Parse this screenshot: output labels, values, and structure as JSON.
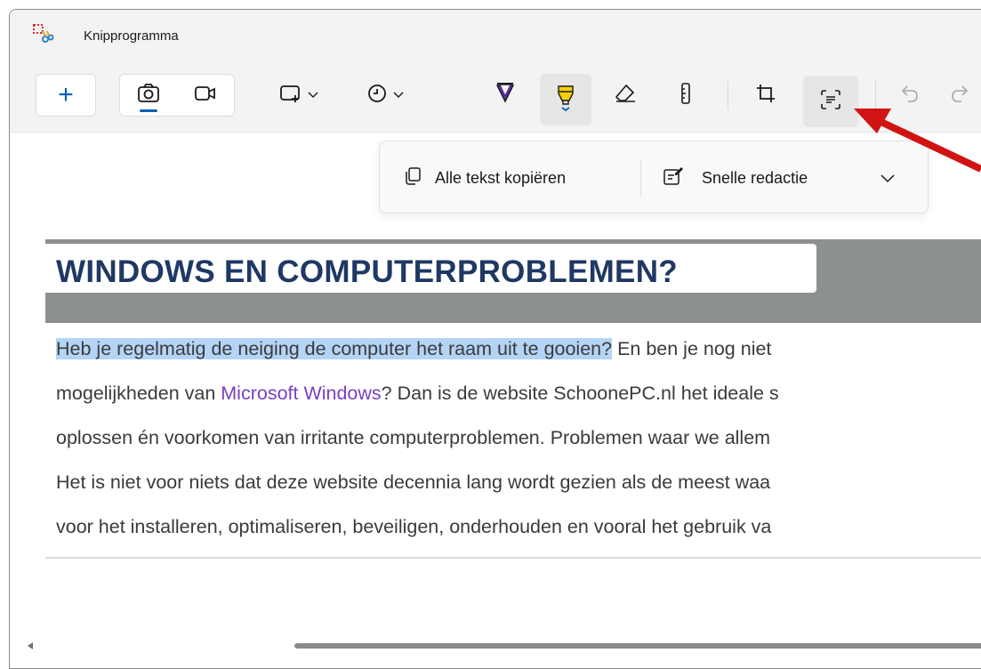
{
  "window": {
    "title": "Knipprogramma"
  },
  "toolbar": {
    "new_label": "+",
    "modes": [
      "photo",
      "video"
    ],
    "shape_mode": "rectangle",
    "delay": "none"
  },
  "text_actions": {
    "copy_all_label": "Alle tekst kopiëren",
    "quick_redact_label": "Snelle redactie"
  },
  "document": {
    "heading": "WINDOWS EN COMPUTERPROBLEMEN?",
    "line1_selected": "Heb je regelmatig de neiging de computer het raam uit te gooien?",
    "line1_rest": " En ben je nog niet",
    "line2_pre": "mogelijkheden van ",
    "line2_link": "Microsoft Windows",
    "line2_post": "? Dan is de website SchoonePC.nl het ideale s",
    "line3": "oplossen én voorkomen van irritante computerproblemen. Problemen waar we allem",
    "line4": "Het is niet voor niets dat deze website decennia lang wordt gezien als de meest waa",
    "line5": "voor het installeren, optimaliseren, beveiligen, onderhouden en vooral het gebruik va"
  },
  "colors": {
    "accent": "#005fb8",
    "highlighter": "#f5d000",
    "pen": "#5a2ea6",
    "arrow": "#d01414",
    "heading": "#1f3864",
    "link": "#7b3fc4",
    "selection": "#b4d4f6"
  }
}
